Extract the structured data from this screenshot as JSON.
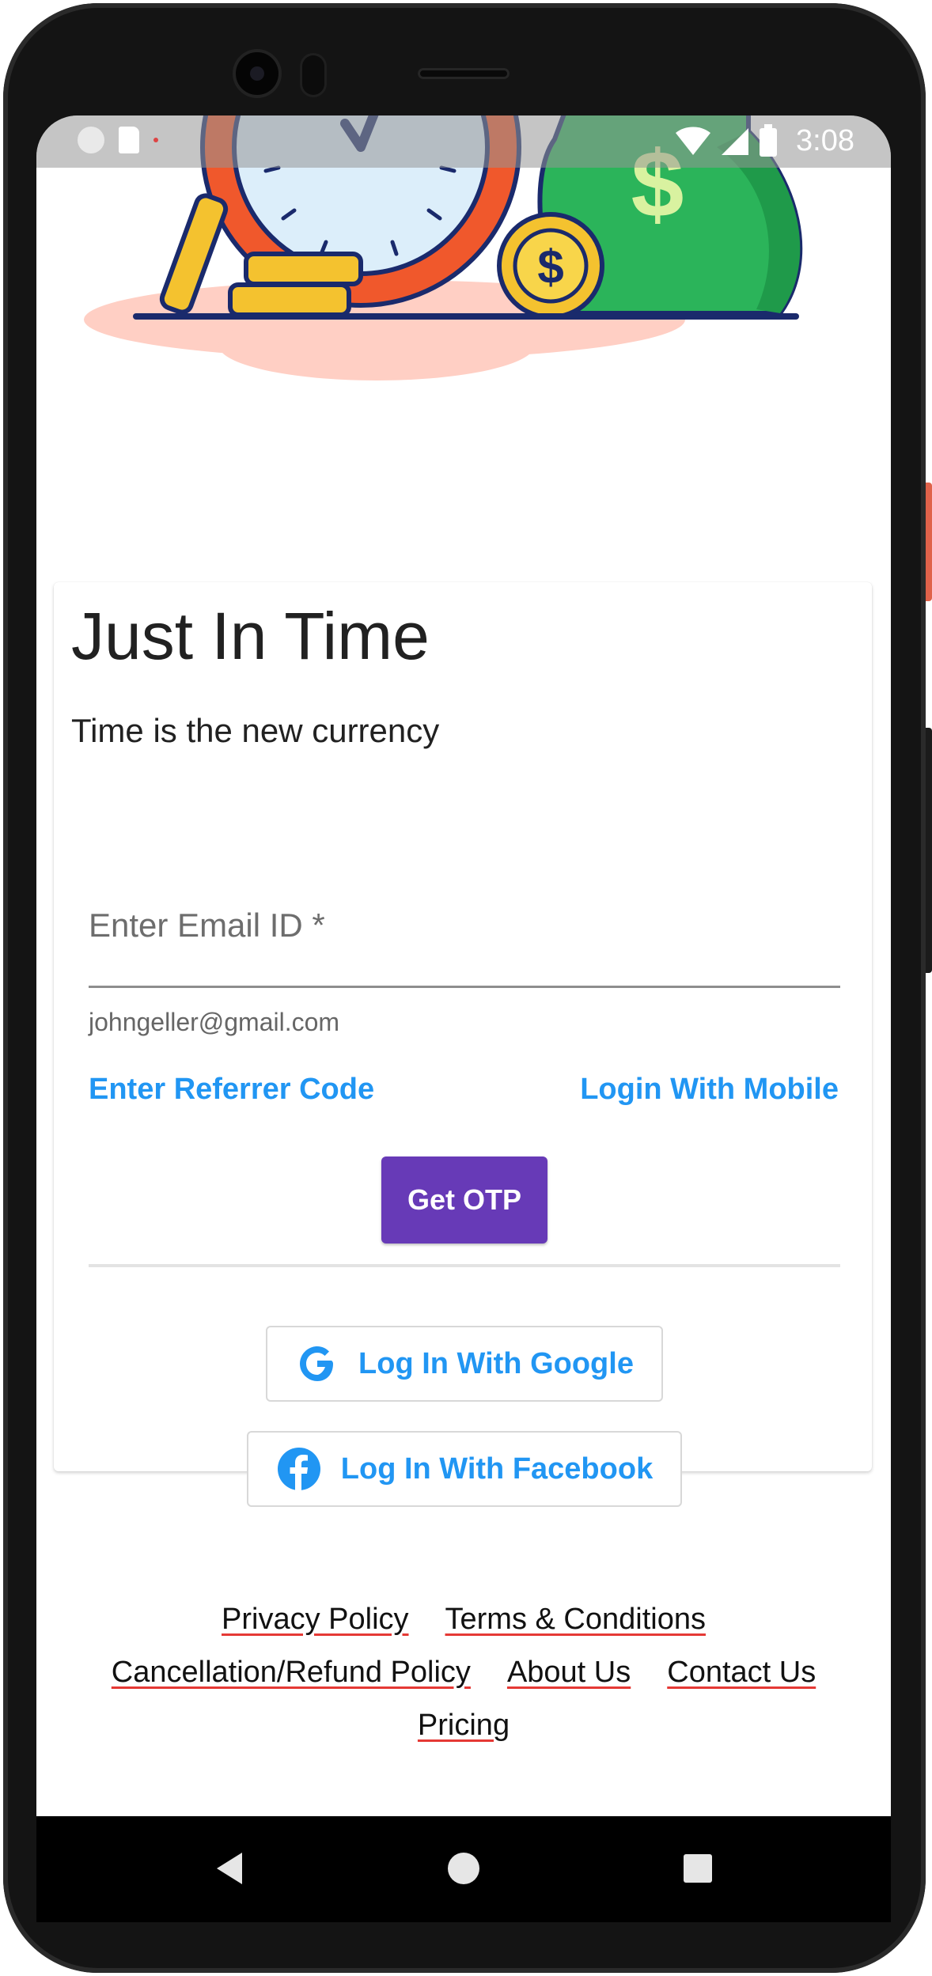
{
  "status_bar": {
    "time": "3:08",
    "icons": [
      "notification-circle-icon",
      "sd-card-icon",
      "wifi-icon",
      "signal-icon",
      "battery-icon"
    ]
  },
  "hero": {
    "illustration": "clock-coins-money-bag-illustration",
    "currency_symbol": "$"
  },
  "card": {
    "title": "Just In Time",
    "subtitle": "Time is the new currency",
    "email_field": {
      "label": "Enter Email ID *",
      "value": "johngeller@gmail.com"
    },
    "referrer_link": "Enter Referrer Code",
    "mobile_link": "Login With Mobile",
    "otp_button": "Get OTP",
    "google_button": "Log In With Google",
    "facebook_button": "Log In With Facebook"
  },
  "footer": {
    "links": {
      "privacy": "Privacy Policy",
      "terms": "Terms & Conditions",
      "refund": "Cancellation/Refund Policy",
      "about": "About Us",
      "contact": "Contact Us",
      "pricing": "Pricing"
    }
  },
  "colors": {
    "primary_button": "#673ab7",
    "link": "#2196f3",
    "text": "#212121",
    "underline": "#e53935",
    "money_bag": "#2bb45a",
    "clock_ring": "#f0582c",
    "coin": "#f4c22f"
  }
}
